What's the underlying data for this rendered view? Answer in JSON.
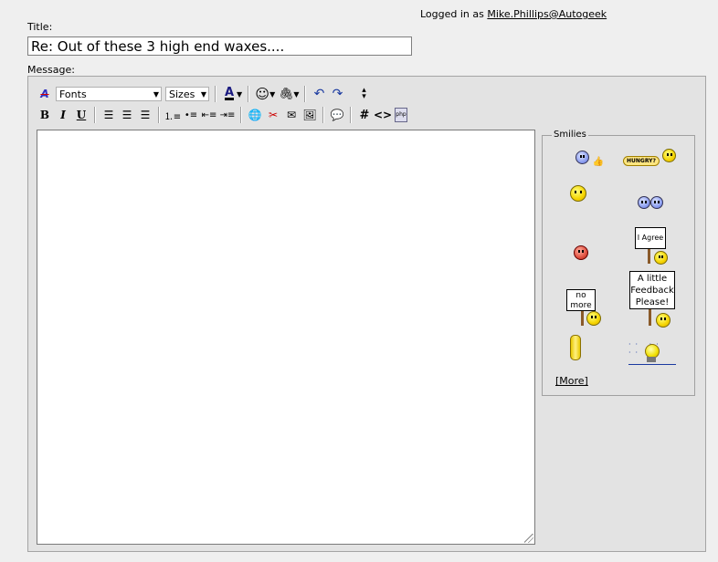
{
  "header": {
    "logged_in_prefix": "Logged in as",
    "username": "Mike.Phillips@Autogeek"
  },
  "form": {
    "title_label": "Title:",
    "title_value": "Re: Out of these 3 high end waxes....",
    "message_label": "Message:"
  },
  "toolbar": {
    "font_select": "Fonts",
    "size_select": "Sizes",
    "bold": "B",
    "italic": "I",
    "underline": "U",
    "hash": "#",
    "code": "<>",
    "font_color_letter": "A"
  },
  "smilies": {
    "legend": "Smilies",
    "hungry_text": "HUNGRY?",
    "agree_text": "I Agree",
    "nomore_text": "no more",
    "feedback_text": "A little Feedback Please!",
    "more_link": "[More]"
  }
}
